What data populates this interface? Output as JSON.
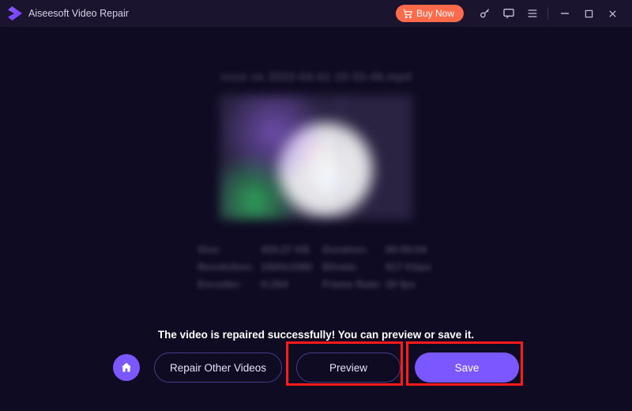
{
  "titlebar": {
    "app_name": "Aiseesoft Video Repair",
    "buy_now_label": "Buy Now"
  },
  "result": {
    "filename_blurred": "xxxx xx 2022-04-01 10-33-49.mp4",
    "success_message": "The video is repaired successfully! You can preview or save it.",
    "meta_rows": [
      {
        "k1": "Size:",
        "v1": "429.27 KB",
        "k2": "Duration:",
        "v2": "00:00:04"
      },
      {
        "k1": "Resolution:",
        "v1": "1920x1080",
        "k2": "Bitrate:",
        "v2": "817 Kbps"
      },
      {
        "k1": "Encoder:",
        "v1": "H.264",
        "k2": "Frame Rate:",
        "v2": "30 fps"
      }
    ]
  },
  "buttons": {
    "repair_other": "Repair Other Videos",
    "preview": "Preview",
    "save": "Save"
  },
  "colors": {
    "accent": "#7b57ff",
    "buy_now": "#ff6b4a",
    "highlight": "#ff1a1a",
    "background": "#0f0b22"
  }
}
